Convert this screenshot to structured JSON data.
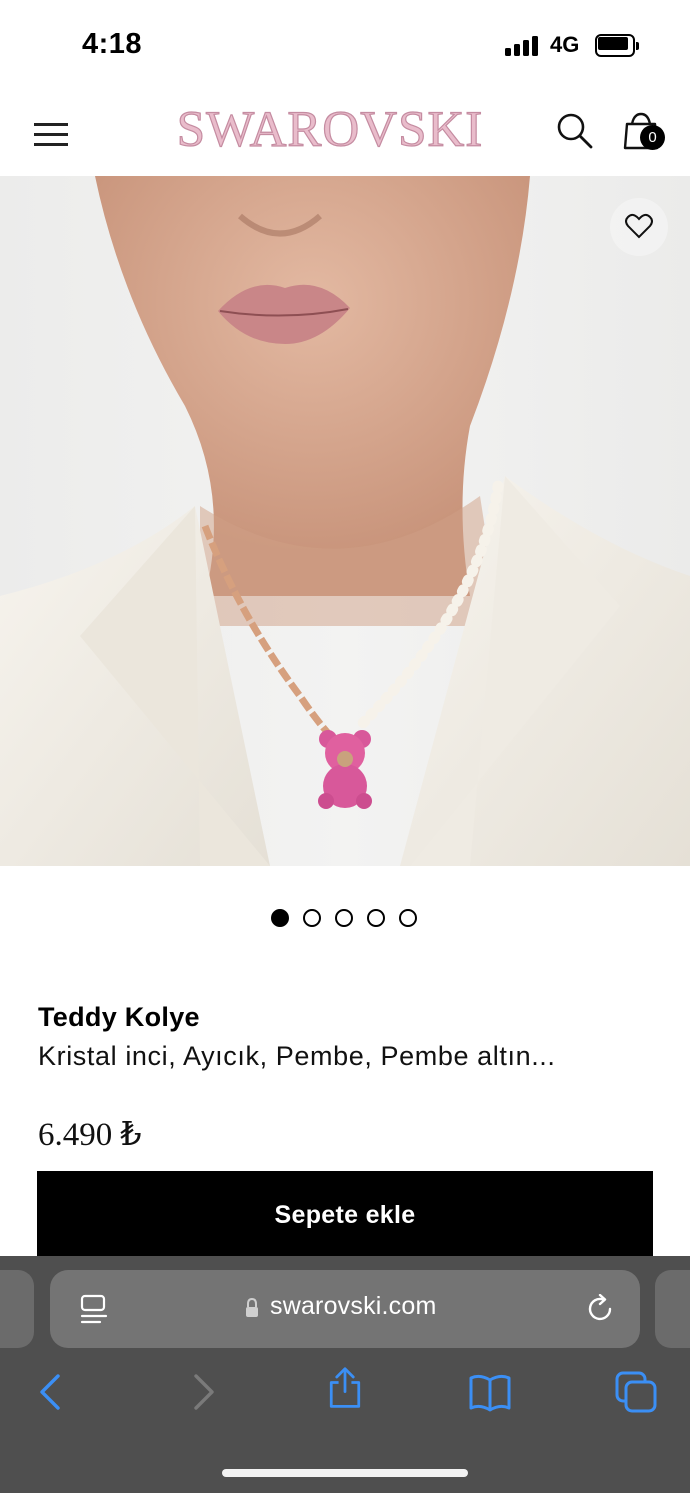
{
  "status_bar": {
    "time": "4:18",
    "network": "4G"
  },
  "header": {
    "brand": "SWAROVSKI",
    "cart_count": "0",
    "icons": [
      "menu-icon",
      "search-icon",
      "shopping-bag-icon"
    ]
  },
  "gallery": {
    "image_count": 5,
    "active_index": 0,
    "wishlist_icon": "heart-icon"
  },
  "product": {
    "name": "Teddy Kolye",
    "description": "Kristal inci, Ayıcık, Pembe, Pembe altın...",
    "price": "6.490 ₺",
    "cta_label": "Sepete ekle"
  },
  "browser": {
    "url": "swarovski.com",
    "toolbar_icons": [
      "back-icon",
      "forward-icon",
      "share-icon",
      "bookmarks-icon",
      "tabs-icon"
    ]
  },
  "colors": {
    "brand_logo": "#e9bccb",
    "cta_background": "#000000",
    "browser_accent": "#3b8ff5",
    "browser_bar": "#4f4f4f"
  }
}
